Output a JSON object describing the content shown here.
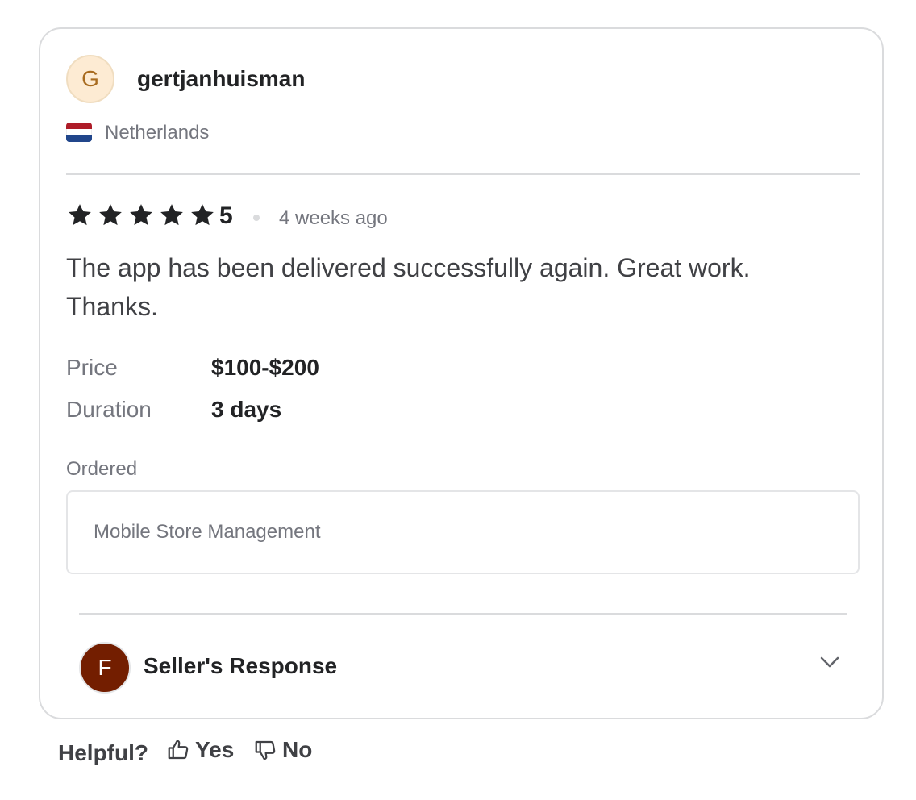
{
  "reviewer": {
    "initial": "G",
    "username": "gertjanhuisman",
    "country": "Netherlands",
    "flag_colors": [
      "#ae1c28",
      "#ffffff",
      "#21468b"
    ]
  },
  "review": {
    "rating": "5",
    "stars": 5,
    "time": "4 weeks ago",
    "text": "The app has been delivered successfully again. Great work. Thanks."
  },
  "meta": {
    "price_label": "Price",
    "price_value": "$100-$200",
    "duration_label": "Duration",
    "duration_value": "3 days"
  },
  "ordered": {
    "label": "Ordered",
    "item": "Mobile Store Management"
  },
  "seller_response": {
    "initial": "F",
    "title": "Seller's Response",
    "toggle_icon": "chevron-down-icon"
  },
  "helpful": {
    "label": "Helpful?",
    "yes": "Yes",
    "no": "No"
  },
  "colors": {
    "star": "#222325",
    "seller_avatar": "#731e00",
    "reviewer_avatar": "#fdebd3"
  }
}
